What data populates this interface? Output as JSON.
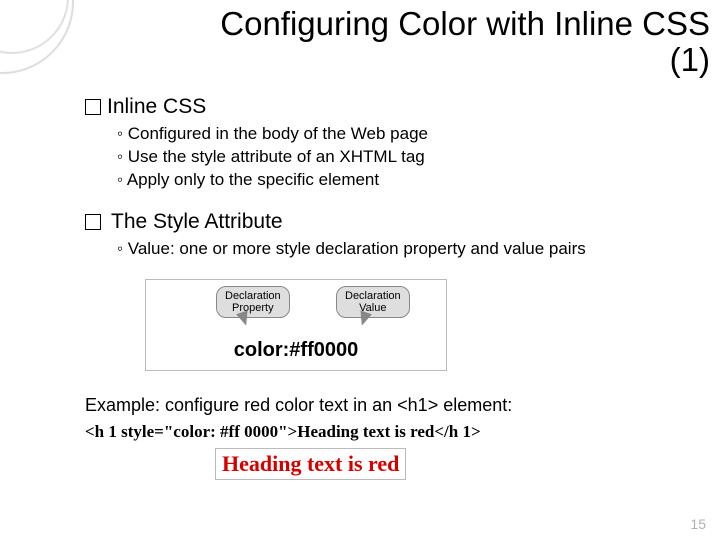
{
  "title_line1": "Configuring Color with Inline CSS",
  "title_line2": "(1)",
  "section1": {
    "heading": "Inline CSS",
    "items": [
      "Configured in the body of the Web page",
      "Use the style attribute of an XHTML tag",
      "Apply only to the specific element"
    ]
  },
  "section2": {
    "heading": "The Style Attribute",
    "items": [
      "Value: one or more style declaration property and value pairs"
    ]
  },
  "callout": {
    "bubble1": "Declaration\nProperty",
    "bubble2": "Declaration\nValue",
    "code": "color:#ff0000"
  },
  "example": {
    "intro": "Example: configure red color text in an <h1> element:",
    "code": "<h 1 style=\"color: #ff 0000\">Heading text is red</h 1>",
    "rendered": "Heading text is red"
  },
  "page_number": "15"
}
